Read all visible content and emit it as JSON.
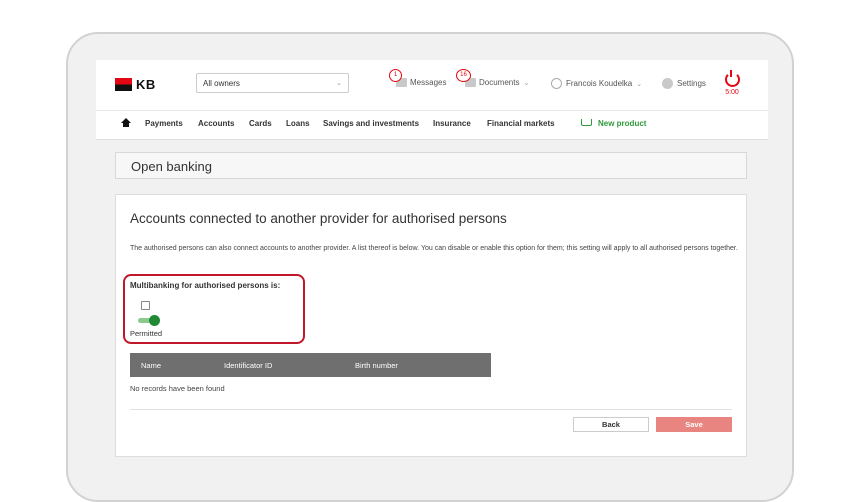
{
  "brand": {
    "logo_text": "KB"
  },
  "header": {
    "owner_select_value": "All owners",
    "messages": {
      "label": "Messages",
      "count": "1"
    },
    "documents": {
      "label": "Documents",
      "count": "16"
    },
    "user_name": "Francois Koudelka",
    "settings_label": "Settings",
    "session_time": "5:00"
  },
  "nav": {
    "items": [
      "Payments",
      "Accounts",
      "Cards",
      "Loans",
      "Savings and investments",
      "Insurance",
      "Financial markets"
    ],
    "new_product": "New product"
  },
  "page": {
    "title": "Open banking"
  },
  "section": {
    "heading": "Accounts connected to another provider for authorised persons",
    "description": "The authorised persons can also connect accounts to another provider. A list thereof is below. You can disable or enable this option for them; this setting will apply to all authorised persons together.",
    "toggle_label": "Multibanking for authorised persons is:",
    "toggle_state": "Permitted",
    "toggle_on": true
  },
  "table": {
    "columns": [
      "Name",
      "Identificator ID",
      "Birth number"
    ],
    "empty_text": "No records have been found"
  },
  "buttons": {
    "back": "Back",
    "save": "Save"
  },
  "colors": {
    "brand_red": "#e30613",
    "toggle_green": "#1f8a33",
    "new_product_green": "#2e9b3a",
    "save_button": "#e98580"
  }
}
